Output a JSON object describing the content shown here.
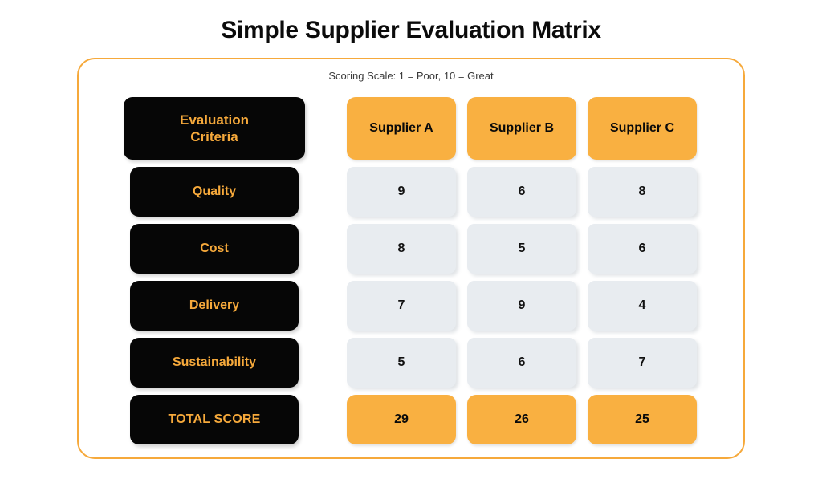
{
  "page": {
    "title": "Simple Supplier Evaluation Matrix",
    "subtitle": "Scoring Scale: 1 = Poor, 10 = Great"
  },
  "colors": {
    "accent_orange": "#F9B041",
    "border_orange": "#F6A93B",
    "dark": "#060606",
    "cell_grey": "#E8ECF0",
    "text_dark": "#0b0b0b"
  },
  "matrix": {
    "criteria_header": "Evaluation\nCriteria",
    "suppliers": [
      "Supplier A",
      "Supplier B",
      "Supplier C"
    ],
    "rows": [
      {
        "criteria": "Quality",
        "scores": [
          "9",
          "6",
          "8"
        ]
      },
      {
        "criteria": "Cost",
        "scores": [
          "8",
          "5",
          "6"
        ]
      },
      {
        "criteria": "Delivery",
        "scores": [
          "7",
          "9",
          "4"
        ]
      },
      {
        "criteria": "Sustainability",
        "scores": [
          "5",
          "6",
          "7"
        ]
      }
    ],
    "total": {
      "label": "TOTAL SCORE",
      "scores": [
        "29",
        "26",
        "25"
      ]
    }
  },
  "chart_data": {
    "type": "table",
    "title": "Simple Supplier Evaluation Matrix",
    "subtitle": "Scoring Scale: 1 = Poor, 10 = Great",
    "columns": [
      "Evaluation Criteria",
      "Supplier A",
      "Supplier B",
      "Supplier C"
    ],
    "categories": [
      "Quality",
      "Cost",
      "Delivery",
      "Sustainability"
    ],
    "series": [
      {
        "name": "Supplier A",
        "values": [
          9,
          8,
          7,
          5
        ],
        "total": 29
      },
      {
        "name": "Supplier B",
        "values": [
          6,
          5,
          9,
          6
        ],
        "total": 26
      },
      {
        "name": "Supplier C",
        "values": [
          8,
          6,
          4,
          7
        ],
        "total": 25
      }
    ],
    "scale": {
      "min": 1,
      "max": 10,
      "min_label": "Poor",
      "max_label": "Great"
    },
    "total_row_label": "TOTAL SCORE",
    "totals": [
      29,
      26,
      25
    ]
  }
}
